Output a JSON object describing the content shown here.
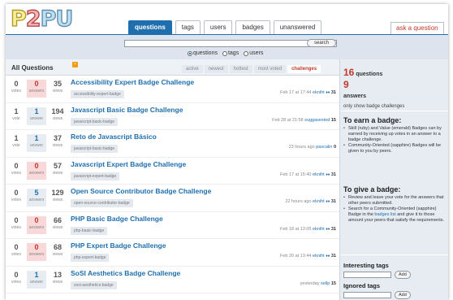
{
  "header": {
    "logo": [
      "P",
      "2",
      "PU"
    ],
    "tabs": [
      {
        "label": "questions",
        "active": true
      },
      {
        "label": "tags",
        "active": false
      },
      {
        "label": "users",
        "active": false
      },
      {
        "label": "badges",
        "active": false
      },
      {
        "label": "unanswered",
        "active": false
      }
    ],
    "ask": "ask a question",
    "search_button": "search",
    "search_value": "",
    "radios": [
      {
        "label": "questions",
        "checked": true
      },
      {
        "label": "tags",
        "checked": false
      },
      {
        "label": "users",
        "checked": false
      }
    ]
  },
  "list": {
    "title": "All Questions",
    "sorts": [
      "active",
      "newest",
      "hottest",
      "most voted",
      "challenges"
    ],
    "active_sort": "challenges",
    "questions": [
      {
        "votes": "0",
        "answers": "0",
        "views": "35",
        "votes_label": "votes",
        "answers_label": "answers",
        "views_label": "views",
        "title": "Accessibility Expert Badge Challenge",
        "tag": "accessibility-expert-badge",
        "time": "Feb 17 at 17:44",
        "user": "ekniht",
        "diamonds": "♦♦",
        "rep": "31",
        "answered": "zero"
      },
      {
        "votes": "1",
        "answers": "1",
        "views": "194",
        "votes_label": "vote",
        "answers_label": "answer",
        "views_label": "views",
        "title": "Javascript Basic Badge Challenge",
        "tag": "javascript-basic-badge",
        "time": "Feb 28 at 21:58",
        "user": "suggasested",
        "diamonds": "",
        "rep": "15",
        "answered": "some"
      },
      {
        "votes": "1",
        "answers": "1",
        "views": "37",
        "votes_label": "vote",
        "answers_label": "answer",
        "views_label": "views",
        "title": "Reto de Javascript Básico",
        "tag": "javascript-basic-badge",
        "time": "23 hours ago",
        "user": "pascalin",
        "diamonds": "",
        "rep": "0",
        "answered": "some"
      },
      {
        "votes": "0",
        "answers": "0",
        "views": "57",
        "votes_label": "votes",
        "answers_label": "answers",
        "views_label": "views",
        "title": "Javascript Expert Badge Challenge",
        "tag": "javascript-expert-badge",
        "time": "Feb 17 at 15:40",
        "user": "ekniht",
        "diamonds": "♦♦",
        "rep": "31",
        "answered": "zero"
      },
      {
        "votes": "0",
        "answers": "5",
        "views": "129",
        "votes_label": "votes",
        "answers_label": "answers",
        "views_label": "views",
        "title": "Open Source Contributor Badge Challenge",
        "tag": "open-source-contributor-badge",
        "time": "22 hours ago",
        "user": "ekniht",
        "diamonds": "♦♦",
        "rep": "31",
        "answered": "some"
      },
      {
        "votes": "0",
        "answers": "0",
        "views": "66",
        "votes_label": "votes",
        "answers_label": "answers",
        "views_label": "views",
        "title": "PHP Basic Badge Challenge",
        "tag": "php-basic-badge",
        "time": "Feb 18 at 13:05",
        "user": "ekniht",
        "diamonds": "♦♦",
        "rep": "31",
        "answered": "zero"
      },
      {
        "votes": "0",
        "answers": "0",
        "views": "68",
        "votes_label": "votes",
        "answers_label": "answers",
        "views_label": "views",
        "title": "PHP Expert Badge Challenge",
        "tag": "php-expert-badge",
        "time": "Feb 20 at 13:44",
        "user": "ekniht",
        "diamonds": "♦♦",
        "rep": "31",
        "answered": "zero"
      },
      {
        "votes": "0",
        "answers": "1",
        "views": "13",
        "votes_label": "votes",
        "answers_label": "answer",
        "views_label": "views",
        "title": "SoSI Aesthetics Badge Challenge",
        "tag": "sosi-aesthetics-badge",
        "time": "yesterday",
        "user": "sellp",
        "diamonds": "",
        "rep": "15",
        "answered": "some"
      }
    ]
  },
  "sidebar": {
    "questions_count": "16",
    "questions_label": "questions",
    "answers_count": "9",
    "answers_label": "answers",
    "only_text": "only show badge challenges",
    "earn_title": "To earn a badge:",
    "earn_items": [
      "Skill (ruby) and Value (emerald) Badges can by earned by receiving up votes in an answer to a badge challenge.",
      "Community-Oriented (sapphire) Badges will be given to you by peers."
    ],
    "give_title": "To give a badge:",
    "give_items": [
      "Review and leave your vote for the answers that other peers submitted.",
      "Search for a Community-Oriented (sapphire) Badge in the",
      "badges list",
      "and give it to those amount your peers that satisfy the requirements."
    ],
    "interesting_tags": "Interesting tags",
    "ignored_tags": "Ignored tags",
    "add": "Add"
  }
}
